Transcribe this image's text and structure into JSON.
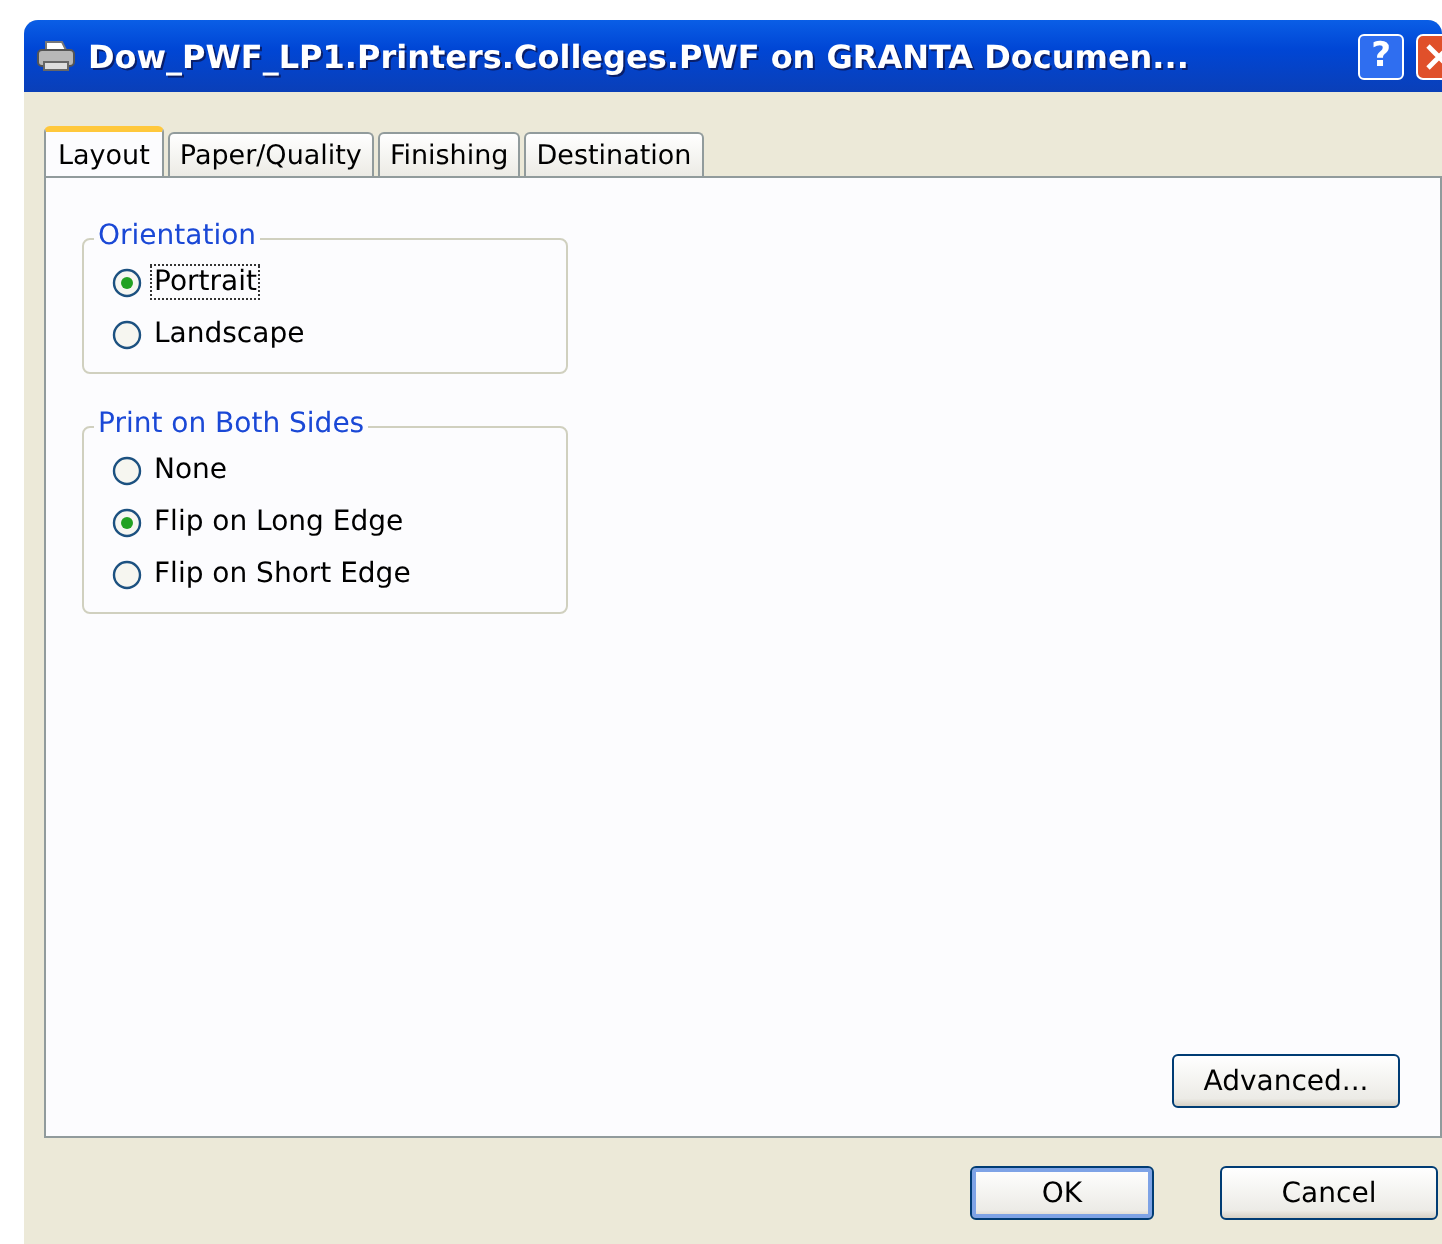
{
  "window": {
    "title": "Dow_PWF_LP1.Printers.Colleges.PWF on GRANTA Documen...",
    "help_button": "?"
  },
  "tabs": [
    {
      "label": "Layout",
      "selected": true
    },
    {
      "label": "Paper/Quality",
      "selected": false
    },
    {
      "label": "Finishing",
      "selected": false
    },
    {
      "label": "Destination",
      "selected": false
    }
  ],
  "groups": [
    {
      "title": "Orientation",
      "options": [
        {
          "label": "Portrait",
          "selected": true,
          "focused": true
        },
        {
          "label": "Landscape",
          "selected": false,
          "focused": false
        }
      ]
    },
    {
      "title": "Print on Both Sides",
      "options": [
        {
          "label": "None",
          "selected": false,
          "focused": false
        },
        {
          "label": "Flip on Long Edge",
          "selected": true,
          "focused": false
        },
        {
          "label": "Flip on Short Edge",
          "selected": false,
          "focused": false
        }
      ]
    }
  ],
  "advanced_button": "Advanced...",
  "buttons": [
    {
      "label": "OK",
      "default": true
    },
    {
      "label": "Cancel",
      "default": false
    }
  ]
}
